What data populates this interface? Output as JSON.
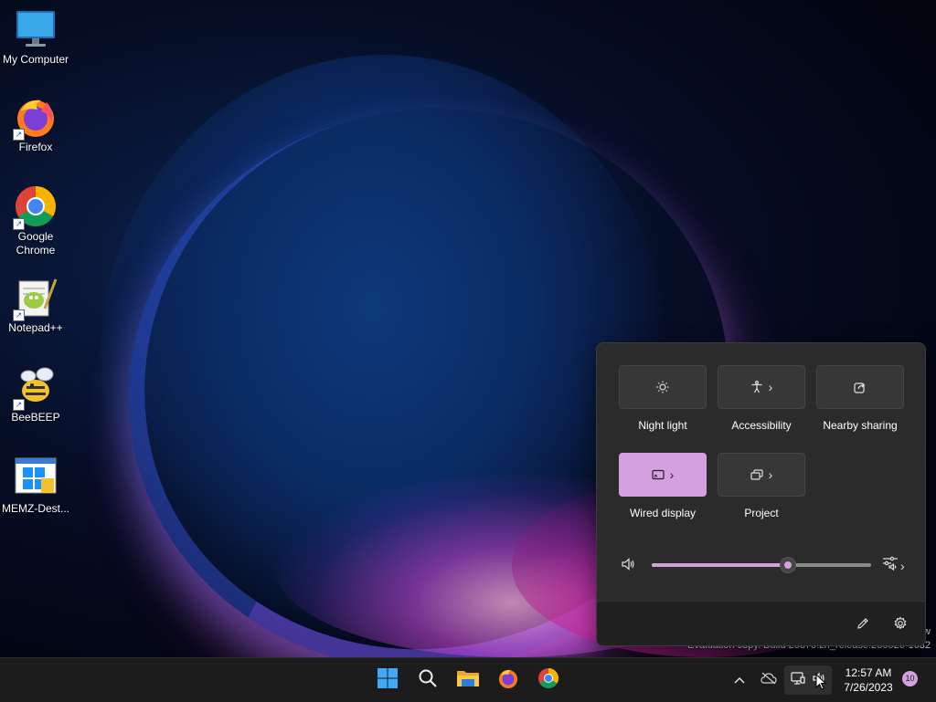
{
  "desktop": {
    "icons": [
      {
        "label": "My Computer"
      },
      {
        "label": "Firefox"
      },
      {
        "label": "Google Chrome"
      },
      {
        "label": "Notepad++"
      },
      {
        "label": "BeeBEEP"
      },
      {
        "label": "MEMZ-Dest..."
      }
    ]
  },
  "quick_settings": {
    "tiles": [
      {
        "label": "Night light",
        "icon": "brightness-icon",
        "active": false,
        "has_chevron": false
      },
      {
        "label": "Accessibility",
        "icon": "accessibility-icon",
        "active": false,
        "has_chevron": true
      },
      {
        "label": "Nearby sharing",
        "icon": "share-icon",
        "active": false,
        "has_chevron": false
      },
      {
        "label": "Wired display",
        "icon": "cast-icon",
        "active": true,
        "has_chevron": true
      },
      {
        "label": "Project",
        "icon": "project-icon",
        "active": false,
        "has_chevron": true
      }
    ],
    "volume": {
      "level_percent": 62
    },
    "footer": {
      "edit_icon": "pencil-icon",
      "settings_icon": "gear-icon"
    }
  },
  "watermark": {
    "line1": "w",
    "line2": "Evaluation copy. Build 25375.zn_release.230520-1632"
  },
  "taskbar": {
    "apps": [
      "start-icon",
      "search-icon",
      "file-explorer-icon",
      "firefox-icon",
      "chrome-icon"
    ],
    "clock": {
      "time": "12:57 AM",
      "date": "7/26/2023"
    },
    "notification_count": "10"
  },
  "colors": {
    "accent": "#d4a0e0",
    "flyout_bg": "#2b2b2b",
    "taskbar_bg": "#1c1c1c"
  }
}
